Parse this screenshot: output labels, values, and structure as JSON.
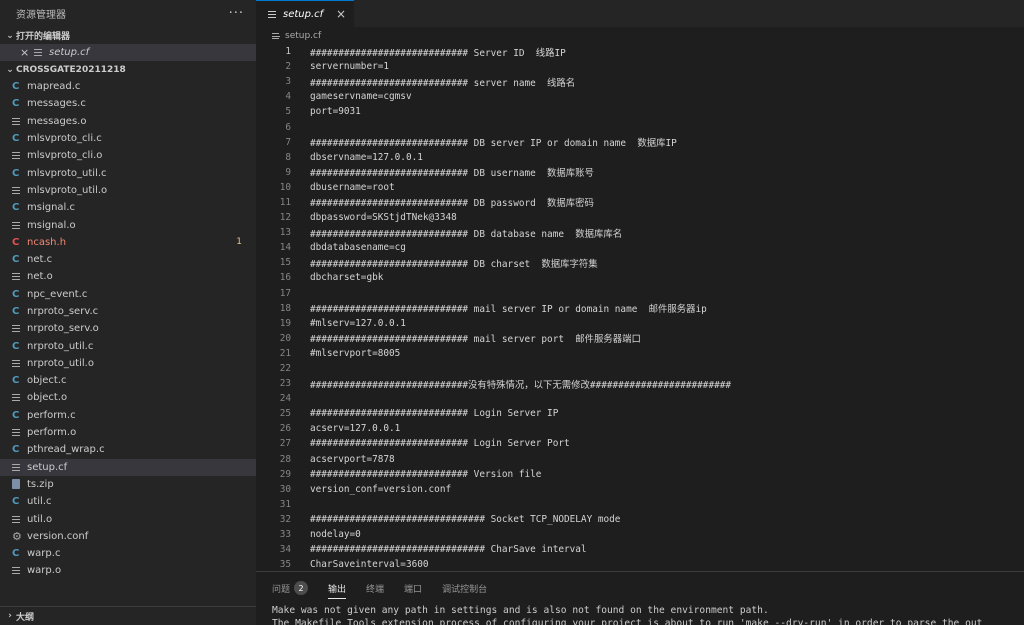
{
  "sidebar": {
    "title": "资源管理器",
    "more": "···",
    "open_editors_header": "打开的编辑器",
    "open_editor": {
      "close": "×",
      "name": "setup.cf"
    },
    "project_header": "CROSSGATE20211218",
    "files": [
      {
        "name": "mapread.c",
        "icon": "c"
      },
      {
        "name": "messages.c",
        "icon": "c"
      },
      {
        "name": "messages.o",
        "icon": "lines"
      },
      {
        "name": "mlsvproto_cli.c",
        "icon": "c"
      },
      {
        "name": "mlsvproto_cli.o",
        "icon": "lines"
      },
      {
        "name": "mlsvproto_util.c",
        "icon": "c"
      },
      {
        "name": "mlsvproto_util.o",
        "icon": "lines"
      },
      {
        "name": "msignal.c",
        "icon": "c"
      },
      {
        "name": "msignal.o",
        "icon": "lines"
      },
      {
        "name": "ncash.h",
        "icon": "c-red",
        "badge": "1"
      },
      {
        "name": "net.c",
        "icon": "c"
      },
      {
        "name": "net.o",
        "icon": "lines"
      },
      {
        "name": "npc_event.c",
        "icon": "c"
      },
      {
        "name": "nrproto_serv.c",
        "icon": "c"
      },
      {
        "name": "nrproto_serv.o",
        "icon": "lines"
      },
      {
        "name": "nrproto_util.c",
        "icon": "c"
      },
      {
        "name": "nrproto_util.o",
        "icon": "lines"
      },
      {
        "name": "object.c",
        "icon": "c"
      },
      {
        "name": "object.o",
        "icon": "lines"
      },
      {
        "name": "perform.c",
        "icon": "c"
      },
      {
        "name": "perform.o",
        "icon": "lines"
      },
      {
        "name": "pthread_wrap.c",
        "icon": "c"
      },
      {
        "name": "setup.cf",
        "icon": "lines",
        "selected": true
      },
      {
        "name": "ts.zip",
        "icon": "zip"
      },
      {
        "name": "util.c",
        "icon": "c"
      },
      {
        "name": "util.o",
        "icon": "lines"
      },
      {
        "name": "version.conf",
        "icon": "gear"
      },
      {
        "name": "warp.c",
        "icon": "c"
      },
      {
        "name": "warp.o",
        "icon": "lines"
      }
    ],
    "outline_header": "大纲"
  },
  "editor": {
    "tab": {
      "name": "setup.cf",
      "close": "×"
    },
    "title_fragment": "▀ ▀▀▀▀▀▀▀",
    "breadcrumb": "setup.cf",
    "current_line": 1,
    "lines": [
      "############################ Server ID  线路IP",
      "servernumber=1",
      "############################ server name  线路名",
      "gameservname=cgmsv",
      "port=9031",
      "",
      "############################ DB server IP or domain name  数据库IP",
      "dbservname=127.0.0.1",
      "############################ DB username  数据库账号",
      "dbusername=root",
      "############################ DB password  数据库密码",
      "dbpassword=SKStjdTNek@3348",
      "############################ DB database name  数据库库名",
      "dbdatabasename=cg",
      "############################ DB charset  数据库字符集",
      "dbcharset=gbk",
      "",
      "############################ mail server IP or domain name  邮件服务器ip",
      "#mlserv=127.0.0.1",
      "############################ mail server port  邮件服务器端口",
      "#mlservport=8005",
      "",
      "############################没有特殊情况，以下无需修改#########################",
      "",
      "############################ Login Server IP",
      "acserv=127.0.0.1",
      "############################ Login Server Port",
      "acservport=7878",
      "############################ Version file",
      "version_conf=version.conf",
      "",
      "############################### Socket TCP_NODELAY mode",
      "nodelay=0",
      "############################### CharSave interval",
      "CharSaveinterval=3600"
    ]
  },
  "panel": {
    "tabs": [
      {
        "label": "问题",
        "badge": "2"
      },
      {
        "label": "输出",
        "active": true
      },
      {
        "label": "终端"
      },
      {
        "label": "端口"
      },
      {
        "label": "调试控制台"
      }
    ],
    "output": [
      "Make was not given any path in settings and is also not found on the environment path.",
      "The Makefile Tools extension process of configuring your project is about to run 'make --dry-run' in order to parse the out"
    ]
  }
}
